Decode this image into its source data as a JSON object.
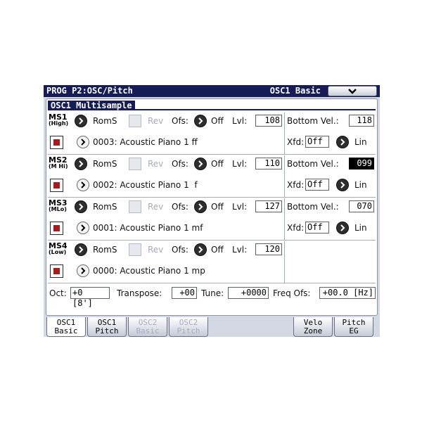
{
  "title": {
    "left": "PROG P2:OSC/Pitch",
    "right": "OSC1 Basic"
  },
  "section_title": "OSC1 Multisample",
  "labels": {
    "roms": "RomS",
    "rev": "Rev",
    "ofs": "Ofs:",
    "off": "Off",
    "lvl": "Lvl:",
    "bottom_vel": "Bottom Vel.:",
    "xfd": "Xfd:",
    "lin": "Lin"
  },
  "multisamples": [
    {
      "name": "MS1",
      "sub": "(High)",
      "level": "108",
      "sample": "0003: Acoustic Piano 1 ff",
      "bottom_vel": "118",
      "xfd": "Off",
      "xfd_curve": "Lin"
    },
    {
      "name": "MS2",
      "sub": "(M Hi)",
      "level": "110",
      "sample": "0002: Acoustic Piano 1  f",
      "bottom_vel": "099",
      "xfd": "Off",
      "xfd_curve": "Lin"
    },
    {
      "name": "MS3",
      "sub": "(MLo)",
      "level": "127",
      "sample": "0001: Acoustic Piano 1 mf",
      "bottom_vel": "070",
      "xfd": "Off",
      "xfd_curve": "Lin"
    },
    {
      "name": "MS4",
      "sub": "(Low)",
      "level": "120",
      "sample": "0000: Acoustic Piano 1 mp"
    }
  ],
  "bottom": {
    "oct_label": "Oct:",
    "oct_value": "+0 [8']",
    "transpose_label": "Transpose:",
    "transpose_value": "+00",
    "tune_label": "Tune:",
    "tune_value": "+0000",
    "freq_label": "Freq Ofs:",
    "freq_value": "+00.0 [Hz]"
  },
  "tabs": [
    {
      "l1": "OSC1",
      "l2": "Basic"
    },
    {
      "l1": "OSC1",
      "l2": "Pitch"
    },
    {
      "l1": "OSC2",
      "l2": "Basic"
    },
    {
      "l1": "OSC2",
      "l2": "Pitch"
    },
    {
      "l1": "Velo",
      "l2": "Zone"
    },
    {
      "l1": "Pitch",
      "l2": "EG"
    }
  ],
  "icons": {
    "menu": "chevron-down-icon",
    "sample_select": "chevron-right-icon",
    "drum_toggle": "red-square-icon"
  },
  "colors": {
    "title_bar": "#151c56",
    "selected_value": "#000000",
    "red_button": "#a51c1c"
  }
}
